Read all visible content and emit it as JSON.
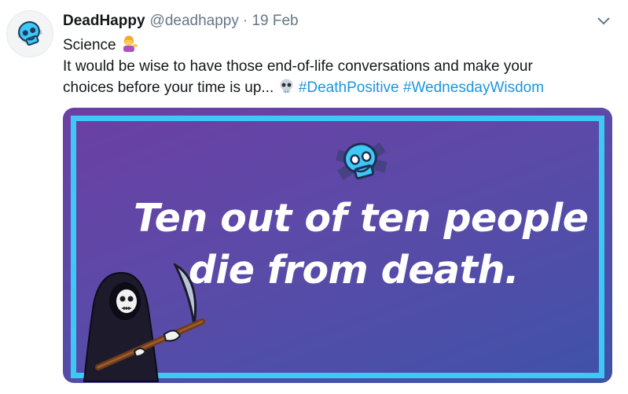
{
  "tweet": {
    "author_name": "DeadHappy",
    "author_handle": "@deadhappy",
    "date_meta": "· 19 Feb",
    "text_line1": "Science",
    "text_line2": "It would be wise to have those end-of-life conversations and make your",
    "text_line3": "choices before your time is up...",
    "hashtag1": "#DeathPositive",
    "hashtag2": "#WednesdayWisdom"
  },
  "image": {
    "headline_line1": "Ten out of ten people",
    "headline_line2": "die from death."
  },
  "icons": {
    "avatar": "skull-logo-icon",
    "menu": "chevron-down-icon",
    "emoji_person": "person-tipping-hand-emoji-icon",
    "emoji_skull": "skull-emoji-icon",
    "image_logo": "skull-logo-icon",
    "reaper": "grim-reaper-illustration"
  },
  "colors": {
    "hashtag": "#1b95e0",
    "frame": "#3ec8f5",
    "card_top": "#6b3fa3",
    "card_bottom": "#3f52a8"
  }
}
